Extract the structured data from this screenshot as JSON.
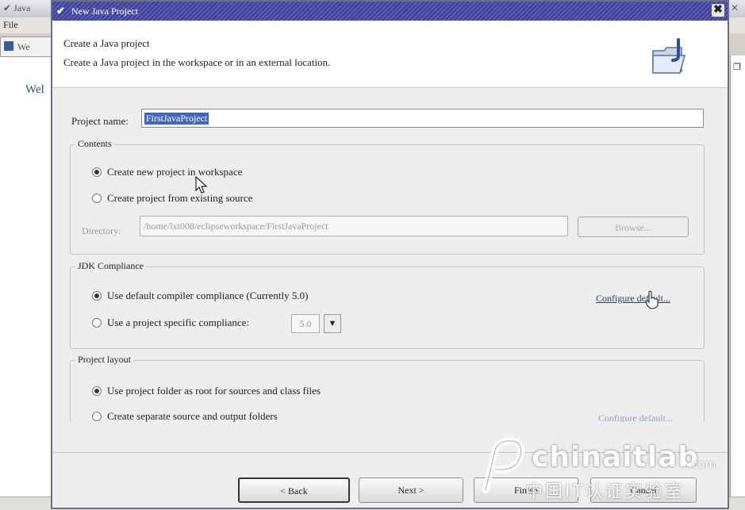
{
  "background": {
    "window_title": "Java",
    "menu_file": "File",
    "tab_label": "We",
    "welcome_text": "Wel"
  },
  "dialog": {
    "title": "New Java Project",
    "header_title": "Create a Java project",
    "header_description": "Create a Java project in the workspace or in an external location.",
    "project_name_label": "Project name:",
    "project_name_value": "FirstJavaProject"
  },
  "contents": {
    "group_label": "Contents",
    "option_new_workspace": "Create new project in workspace",
    "option_existing_source": "Create project from existing source",
    "directory_label": "Directory:",
    "directory_value": "/home/lxt008/eclipseworkspace/FirstJavaProject",
    "browse_label": "Browse...",
    "selected": "option_new_workspace"
  },
  "jdk": {
    "group_label": "JDK Compliance",
    "option_default": "Use default compiler compliance (Currently 5.0)",
    "option_specific": "Use a project specific compliance:",
    "compliance_value": "5.0",
    "configure_link": "Configure default...",
    "selected": "option_default"
  },
  "layout": {
    "group_label": "Project layout",
    "option_root": "Use project folder as root for sources and class files",
    "option_separate": "Create separate source and output folders",
    "configure_link": "Configure default...",
    "selected": "option_root"
  },
  "buttons": {
    "back": "< Back",
    "next": "Next >",
    "finish": "Finish",
    "cancel": "Cancel"
  },
  "watermark": {
    "brand": "chinaitlab",
    "domain_suffix": ".com",
    "chinese": "中国IT认证实验室"
  }
}
